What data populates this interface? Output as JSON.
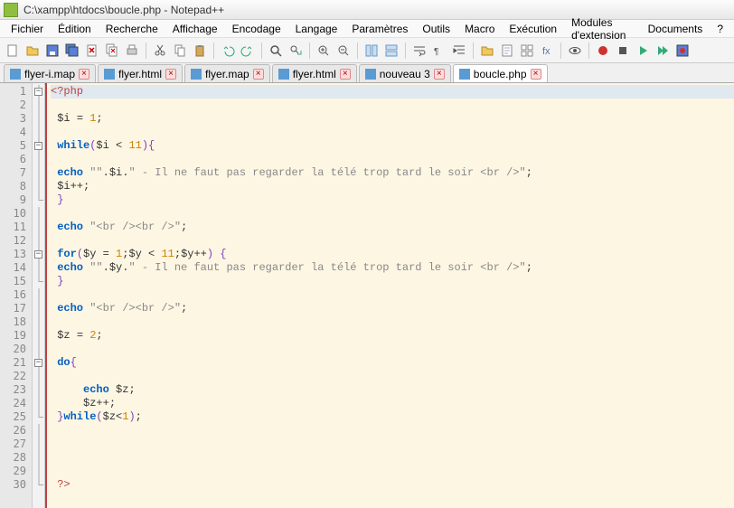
{
  "titlebar": {
    "text": "C:\\xampp\\htdocs\\boucle.php - Notepad++"
  },
  "menubar": {
    "items": [
      "Fichier",
      "Édition",
      "Recherche",
      "Affichage",
      "Encodage",
      "Langage",
      "Paramètres",
      "Outils",
      "Macro",
      "Exécution",
      "Modules d'extension",
      "Documents",
      "?"
    ]
  },
  "toolbar": {
    "icons": [
      "new-file-icon",
      "open-file-icon",
      "save-icon",
      "save-all-icon",
      "close-icon",
      "close-all-icon",
      "print-icon",
      "sep",
      "cut-icon",
      "copy-icon",
      "paste-icon",
      "sep",
      "undo-icon",
      "redo-icon",
      "sep",
      "find-icon",
      "replace-icon",
      "sep",
      "zoom-in-icon",
      "zoom-out-icon",
      "sep",
      "sync-v-icon",
      "sync-h-icon",
      "sep",
      "wrap-icon",
      "show-chars-icon",
      "indent-icon",
      "sep",
      "folder-icon",
      "doc-map-icon",
      "doc-list-icon",
      "func-list-icon",
      "sep",
      "eye-icon",
      "sep",
      "record-icon",
      "stop-icon",
      "play-icon",
      "play-multi-icon",
      "save-macro-icon"
    ]
  },
  "tabs": [
    {
      "label": "flyer-i.map",
      "active": false
    },
    {
      "label": "flyer.html",
      "active": false
    },
    {
      "label": "flyer.map",
      "active": false
    },
    {
      "label": "flyer.html",
      "active": false
    },
    {
      "label": "nouveau 3",
      "active": false
    },
    {
      "label": "boucle.php",
      "active": true
    }
  ],
  "code": {
    "lines": [
      {
        "n": 1,
        "fold": "box",
        "html": "<span class='k-tag'>&lt;?php</span>"
      },
      {
        "n": 2,
        "fold": "line",
        "html": ""
      },
      {
        "n": 3,
        "fold": "line",
        "html": " <span class='k-var'>$i</span> <span class='k-op'>=</span> <span class='k-num'>1</span><span class='k-op'>;</span>"
      },
      {
        "n": 4,
        "fold": "line",
        "html": ""
      },
      {
        "n": 5,
        "fold": "box",
        "html": " <span class='k-key'>while</span><span class='k-punc'>(</span><span class='k-var'>$i</span> <span class='k-op'>&lt;</span> <span class='k-num'>11</span><span class='k-punc'>)</span><span class='k-punc'>{</span>"
      },
      {
        "n": 6,
        "fold": "line",
        "html": ""
      },
      {
        "n": 7,
        "fold": "line",
        "html": " <span class='k-key'>echo</span> <span class='k-str'>\"\"</span><span class='k-op'>.</span><span class='k-var'>$i</span><span class='k-op'>.</span><span class='k-str'>\" - Il ne faut pas regarder la télé trop tard le soir &lt;br /&gt;\"</span><span class='k-op'>;</span>"
      },
      {
        "n": 8,
        "fold": "line",
        "html": " <span class='k-var'>$i</span><span class='k-op'>++;</span>"
      },
      {
        "n": 9,
        "fold": "end",
        "html": " <span class='k-punc'>}</span>"
      },
      {
        "n": 10,
        "fold": "line",
        "html": ""
      },
      {
        "n": 11,
        "fold": "line",
        "html": " <span class='k-key'>echo</span> <span class='k-str'>\"&lt;br /&gt;&lt;br /&gt;\"</span><span class='k-op'>;</span>"
      },
      {
        "n": 12,
        "fold": "line",
        "html": ""
      },
      {
        "n": 13,
        "fold": "box",
        "html": " <span class='k-key'>for</span><span class='k-punc'>(</span><span class='k-var'>$y</span> <span class='k-op'>=</span> <span class='k-num'>1</span><span class='k-op'>;</span><span class='k-var'>$y</span> <span class='k-op'>&lt;</span> <span class='k-num'>11</span><span class='k-op'>;</span><span class='k-var'>$y</span><span class='k-op'>++</span><span class='k-punc'>)</span> <span class='k-punc'>{</span>"
      },
      {
        "n": 14,
        "fold": "line",
        "html": " <span class='k-key'>echo</span> <span class='k-str'>\"\"</span><span class='k-op'>.</span><span class='k-var'>$y</span><span class='k-op'>.</span><span class='k-str'>\" - Il ne faut pas regarder la télé trop tard le soir &lt;br /&gt;\"</span><span class='k-op'>;</span>"
      },
      {
        "n": 15,
        "fold": "end",
        "html": " <span class='k-punc'>}</span>"
      },
      {
        "n": 16,
        "fold": "line",
        "html": ""
      },
      {
        "n": 17,
        "fold": "line",
        "html": " <span class='k-key'>echo</span> <span class='k-str'>\"&lt;br /&gt;&lt;br /&gt;\"</span><span class='k-op'>;</span>"
      },
      {
        "n": 18,
        "fold": "line",
        "html": ""
      },
      {
        "n": 19,
        "fold": "line",
        "html": " <span class='k-var'>$z</span> <span class='k-op'>=</span> <span class='k-num'>2</span><span class='k-op'>;</span>"
      },
      {
        "n": 20,
        "fold": "line",
        "html": ""
      },
      {
        "n": 21,
        "fold": "box",
        "html": " <span class='k-key'>do</span><span class='k-punc'>{</span>"
      },
      {
        "n": 22,
        "fold": "line",
        "html": ""
      },
      {
        "n": 23,
        "fold": "line",
        "html": "     <span class='k-key'>echo</span> <span class='k-var'>$z</span><span class='k-op'>;</span>"
      },
      {
        "n": 24,
        "fold": "line",
        "html": "     <span class='k-var'>$z</span><span class='k-op'>++;</span>"
      },
      {
        "n": 25,
        "fold": "end",
        "html": " <span class='k-punc'>}</span><span class='k-key'>while</span><span class='k-punc'>(</span><span class='k-var'>$z</span><span class='k-op'>&lt;</span><span class='k-num'>1</span><span class='k-punc'>)</span><span class='k-op'>;</span>"
      },
      {
        "n": 26,
        "fold": "line",
        "html": ""
      },
      {
        "n": 27,
        "fold": "line",
        "html": ""
      },
      {
        "n": 28,
        "fold": "line",
        "html": ""
      },
      {
        "n": 29,
        "fold": "line",
        "html": ""
      },
      {
        "n": 30,
        "fold": "end",
        "html": " <span class='k-tag'>?&gt;</span>"
      }
    ]
  }
}
